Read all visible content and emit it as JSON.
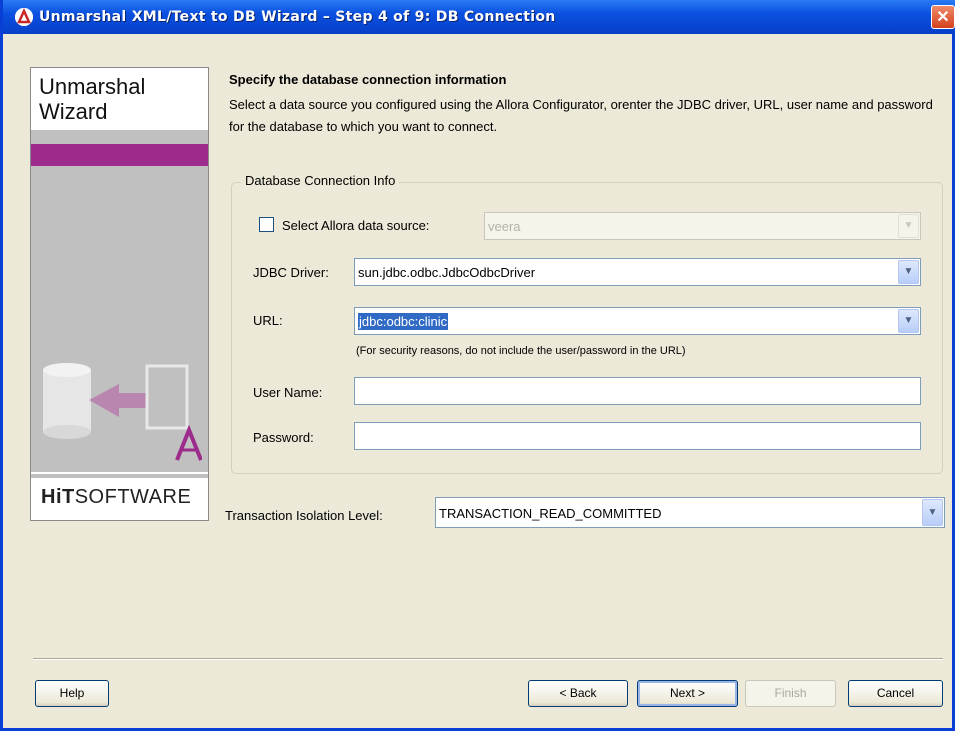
{
  "window": {
    "title": "Unmarshal XML/Text to DB Wizard – Step 4 of 9: DB Connection",
    "app_icon": "altova-logo-icon",
    "close_icon": "close-icon"
  },
  "sidebar": {
    "title_line1": "Unmarshal",
    "title_line2": "Wizard",
    "brand_bold": "HiT",
    "brand_rest": "SOFTWARE",
    "art_icon": "database-import-icon"
  },
  "main": {
    "heading": "Specify the database connection information",
    "description": "Select a data source you configured using the Allora Configurator, orenter the JDBC driver, URL, user name and password for the database to which you want to connect.",
    "group_label": "Database Connection Info",
    "datasource": {
      "checkbox_label": "Select Allora data source:",
      "checked": false,
      "value": "veera"
    },
    "jdbc": {
      "label": "JDBC Driver:",
      "value": "sun.jdbc.odbc.JdbcOdbcDriver"
    },
    "url": {
      "label": "URL:",
      "value": "jdbc:odbc:clinic",
      "note": "(For security reasons, do not include the user/password in the URL)"
    },
    "username": {
      "label": "User Name:",
      "value": ""
    },
    "password": {
      "label": "Password:",
      "value": ""
    },
    "isolation": {
      "label": "Transaction Isolation Level:",
      "value": "TRANSACTION_READ_COMMITTED"
    }
  },
  "buttons": {
    "help": "Help",
    "back": "< Back",
    "next": "Next >",
    "finish": "Finish",
    "cancel": "Cancel"
  },
  "colors": {
    "titlebar": "#0a50e0",
    "accent_purple": "#9c2b8c",
    "selection": "#316ac5",
    "dialog_bg": "#ece9d8"
  }
}
